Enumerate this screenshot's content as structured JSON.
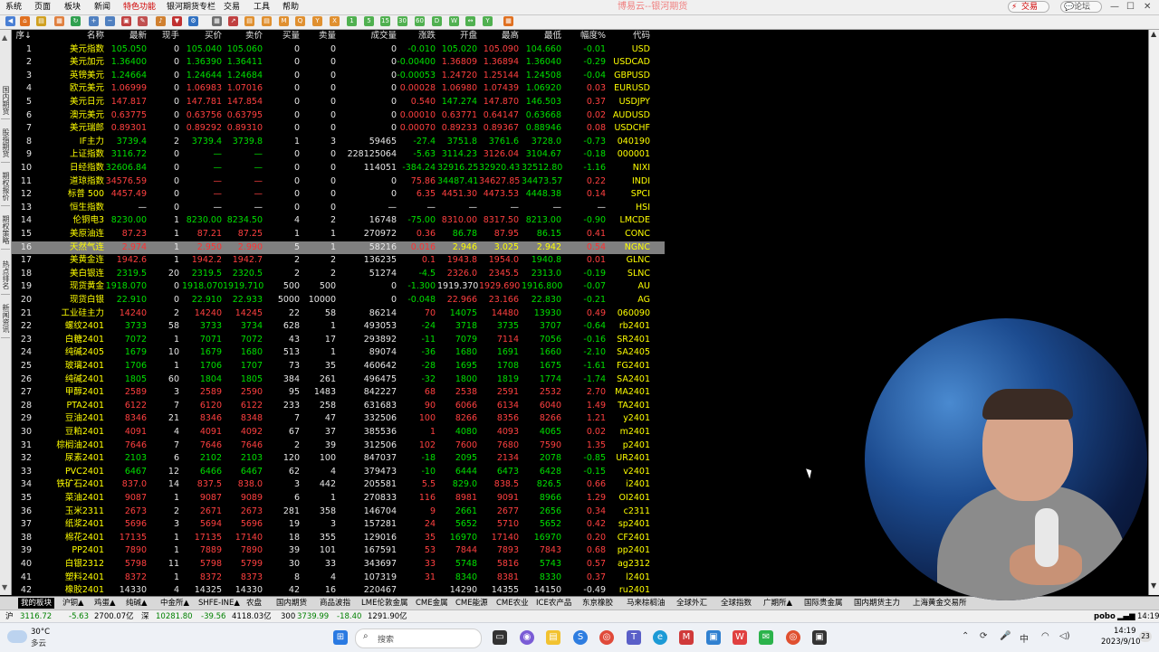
{
  "window": {
    "title": "博易云--银河期货",
    "menu": [
      "系统",
      "页面",
      "板块",
      "新闻",
      "特色功能",
      "银河期货专栏",
      "交易",
      "工具",
      "帮助"
    ],
    "active_menu": "特色功能",
    "trade_button": "交易",
    "forum_button": "论坛"
  },
  "side_tabs": [
    "国内期货",
    "股指期货",
    "期权报价",
    "期权策略",
    "热点排名",
    "新闻资讯"
  ],
  "table": {
    "headers": [
      "序↓",
      "名称",
      "最新",
      "现手",
      "买价",
      "卖价",
      "买量",
      "卖量",
      "成交量",
      "涨跌",
      "开盘",
      "最高",
      "最低",
      "幅度%",
      "代码"
    ],
    "highlight_row_index": 15,
    "rows": [
      [
        "1",
        "美元指数",
        "105.050",
        "0",
        "105.040",
        "105.060",
        "0",
        "0",
        "0",
        "-0.010",
        "105.020",
        "105.090",
        "104.660",
        "-0.01",
        "USD"
      ],
      [
        "2",
        "美元加元",
        "1.36400",
        "0",
        "1.36390",
        "1.36411",
        "0",
        "0",
        "0",
        "-0.00400",
        "1.36809",
        "1.36894",
        "1.36040",
        "-0.29",
        "USDCAD"
      ],
      [
        "3",
        "英镑美元",
        "1.24664",
        "0",
        "1.24644",
        "1.24684",
        "0",
        "0",
        "0",
        "-0.00053",
        "1.24720",
        "1.25144",
        "1.24508",
        "-0.04",
        "GBPUSD"
      ],
      [
        "4",
        "欧元美元",
        "1.06999",
        "0",
        "1.06983",
        "1.07016",
        "0",
        "0",
        "0",
        "0.00028",
        "1.06980",
        "1.07439",
        "1.06920",
        "0.03",
        "EURUSD"
      ],
      [
        "5",
        "美元日元",
        "147.817",
        "0",
        "147.781",
        "147.854",
        "0",
        "0",
        "0",
        "0.540",
        "147.274",
        "147.870",
        "146.503",
        "0.37",
        "USDJPY"
      ],
      [
        "6",
        "澳元美元",
        "0.63775",
        "0",
        "0.63756",
        "0.63795",
        "0",
        "0",
        "0",
        "0.00010",
        "0.63771",
        "0.64147",
        "0.63668",
        "0.02",
        "AUDUSD"
      ],
      [
        "7",
        "美元瑞郎",
        "0.89301",
        "0",
        "0.89292",
        "0.89310",
        "0",
        "0",
        "0",
        "0.00070",
        "0.89233",
        "0.89367",
        "0.88946",
        "0.08",
        "USDCHF"
      ],
      [
        "8",
        "IF主力",
        "3739.4",
        "2",
        "3739.4",
        "3739.8",
        "1",
        "3",
        "59465",
        "-27.4",
        "3751.8",
        "3761.6",
        "3728.0",
        "-0.73",
        "040190"
      ],
      [
        "9",
        "上证指数",
        "3116.72",
        "0",
        "—",
        "—",
        "0",
        "0",
        "228125064",
        "-5.63",
        "3114.23",
        "3126.04",
        "3104.67",
        "-0.18",
        "000001"
      ],
      [
        "10",
        "日经指数",
        "32606.84",
        "0",
        "—",
        "—",
        "0",
        "0",
        "114051",
        "-384.24",
        "32916.25",
        "32920.43",
        "32512.80",
        "-1.16",
        "NIXI"
      ],
      [
        "11",
        "道琼指数",
        "34576.59",
        "0",
        "—",
        "—",
        "0",
        "0",
        "0",
        "75.86",
        "34487.41",
        "34627.85",
        "34473.57",
        "0.22",
        "INDI"
      ],
      [
        "12",
        "标普 500",
        "4457.49",
        "0",
        "—",
        "—",
        "0",
        "0",
        "0",
        "6.35",
        "4451.30",
        "4473.53",
        "4448.38",
        "0.14",
        "SPCI"
      ],
      [
        "13",
        "恒生指数",
        "—",
        "0",
        "—",
        "—",
        "0",
        "0",
        "—",
        "—",
        "—",
        "—",
        "—",
        "—",
        "HSI"
      ],
      [
        "14",
        "伦铜电3",
        "8230.00",
        "1",
        "8230.00",
        "8234.50",
        "4",
        "2",
        "16748",
        "-75.00",
        "8310.00",
        "8317.50",
        "8213.00",
        "-0.90",
        "LMCDE"
      ],
      [
        "15",
        "美原油连",
        "87.23",
        "1",
        "87.21",
        "87.25",
        "1",
        "1",
        "270972",
        "0.36",
        "86.78",
        "87.95",
        "86.15",
        "0.41",
        "CONC"
      ],
      [
        "16",
        "天然气连",
        "2.974",
        "1",
        "2.950",
        "2.990",
        "5",
        "1",
        "58216",
        "0.016",
        "2.946",
        "3.025",
        "2.942",
        "0.54",
        "NGNC"
      ],
      [
        "17",
        "美黄金连",
        "1942.6",
        "1",
        "1942.2",
        "1942.7",
        "2",
        "2",
        "136235",
        "0.1",
        "1943.8",
        "1954.0",
        "1940.8",
        "0.01",
        "GLNC"
      ],
      [
        "18",
        "美白银连",
        "2319.5",
        "20",
        "2319.5",
        "2320.5",
        "2",
        "2",
        "51274",
        "-4.5",
        "2326.0",
        "2345.5",
        "2313.0",
        "-0.19",
        "SLNC"
      ],
      [
        "19",
        "现货黄金",
        "1918.070",
        "0",
        "1918.070",
        "1919.710",
        "500",
        "500",
        "0",
        "-1.300",
        "1919.370",
        "1929.690",
        "1916.800",
        "-0.07",
        "AU"
      ],
      [
        "20",
        "现货白银",
        "22.910",
        "0",
        "22.910",
        "22.933",
        "5000",
        "10000",
        "0",
        "-0.048",
        "22.966",
        "23.166",
        "22.830",
        "-0.21",
        "AG"
      ],
      [
        "21",
        "工业硅主力",
        "14240",
        "2",
        "14240",
        "14245",
        "22",
        "58",
        "86214",
        "70",
        "14075",
        "14480",
        "13930",
        "0.49",
        "060090"
      ],
      [
        "22",
        "螺纹2401",
        "3733",
        "58",
        "3733",
        "3734",
        "628",
        "1",
        "493053",
        "-24",
        "3718",
        "3735",
        "3707",
        "-0.64",
        "rb2401"
      ],
      [
        "23",
        "白糖2401",
        "7072",
        "1",
        "7071",
        "7072",
        "43",
        "17",
        "293892",
        "-11",
        "7079",
        "7114",
        "7056",
        "-0.16",
        "SR2401"
      ],
      [
        "24",
        "纯碱2405",
        "1679",
        "10",
        "1679",
        "1680",
        "513",
        "1",
        "89074",
        "-36",
        "1680",
        "1691",
        "1660",
        "-2.10",
        "SA2405"
      ],
      [
        "25",
        "玻璃2401",
        "1706",
        "1",
        "1706",
        "1707",
        "73",
        "35",
        "460642",
        "-28",
        "1695",
        "1708",
        "1675",
        "-1.61",
        "FG2401"
      ],
      [
        "26",
        "纯碱2401",
        "1805",
        "60",
        "1804",
        "1805",
        "384",
        "261",
        "496475",
        "-32",
        "1800",
        "1819",
        "1774",
        "-1.74",
        "SA2401"
      ],
      [
        "27",
        "甲醇2401",
        "2589",
        "3",
        "2589",
        "2590",
        "95",
        "1483",
        "842227",
        "68",
        "2538",
        "2591",
        "2532",
        "2.70",
        "MA2401"
      ],
      [
        "28",
        "PTA2401",
        "6122",
        "7",
        "6120",
        "6122",
        "233",
        "258",
        "631683",
        "90",
        "6066",
        "6134",
        "6040",
        "1.49",
        "TA2401"
      ],
      [
        "29",
        "豆油2401",
        "8346",
        "21",
        "8346",
        "8348",
        "7",
        "47",
        "332506",
        "100",
        "8266",
        "8356",
        "8266",
        "1.21",
        "y2401"
      ],
      [
        "30",
        "豆粕2401",
        "4091",
        "4",
        "4091",
        "4092",
        "67",
        "37",
        "385536",
        "1",
        "4080",
        "4093",
        "4065",
        "0.02",
        "m2401"
      ],
      [
        "31",
        "棕榈油2401",
        "7646",
        "7",
        "7646",
        "7646",
        "2",
        "39",
        "312506",
        "102",
        "7600",
        "7680",
        "7590",
        "1.35",
        "p2401"
      ],
      [
        "32",
        "尿素2401",
        "2103",
        "6",
        "2102",
        "2103",
        "120",
        "100",
        "847037",
        "-18",
        "2095",
        "2134",
        "2078",
        "-0.85",
        "UR2401"
      ],
      [
        "33",
        "PVC2401",
        "6467",
        "12",
        "6466",
        "6467",
        "62",
        "4",
        "379473",
        "-10",
        "6444",
        "6473",
        "6428",
        "-0.15",
        "v2401"
      ],
      [
        "34",
        "铁矿石2401",
        "837.0",
        "14",
        "837.5",
        "838.0",
        "3",
        "442",
        "205581",
        "5.5",
        "829.0",
        "838.5",
        "826.5",
        "0.66",
        "i2401"
      ],
      [
        "35",
        "菜油2401",
        "9087",
        "1",
        "9087",
        "9089",
        "6",
        "1",
        "270833",
        "116",
        "8981",
        "9091",
        "8966",
        "1.29",
        "OI2401"
      ],
      [
        "36",
        "玉米2311",
        "2673",
        "2",
        "2671",
        "2673",
        "281",
        "358",
        "146704",
        "9",
        "2661",
        "2677",
        "2656",
        "0.34",
        "c2311"
      ],
      [
        "37",
        "纸浆2401",
        "5696",
        "3",
        "5694",
        "5696",
        "19",
        "3",
        "157281",
        "24",
        "5652",
        "5710",
        "5652",
        "0.42",
        "sp2401"
      ],
      [
        "38",
        "棉花2401",
        "17135",
        "1",
        "17135",
        "17140",
        "18",
        "355",
        "129016",
        "35",
        "16970",
        "17140",
        "16970",
        "0.20",
        "CF2401"
      ],
      [
        "39",
        "PP2401",
        "7890",
        "1",
        "7889",
        "7890",
        "39",
        "101",
        "167591",
        "53",
        "7844",
        "7893",
        "7843",
        "0.68",
        "pp2401"
      ],
      [
        "40",
        "白银2312",
        "5798",
        "11",
        "5798",
        "5799",
        "30",
        "33",
        "343697",
        "33",
        "5748",
        "5816",
        "5743",
        "0.57",
        "ag2312"
      ],
      [
        "41",
        "塑料2401",
        "8372",
        "1",
        "8372",
        "8373",
        "8",
        "4",
        "107319",
        "31",
        "8340",
        "8381",
        "8330",
        "0.37",
        "l2401"
      ],
      [
        "42",
        "橡胶2401",
        "14330",
        "4",
        "14325",
        "14330",
        "42",
        "16",
        "220467",
        "",
        "14290",
        "14355",
        "14150",
        "-0.49",
        "ru2401"
      ]
    ]
  },
  "bottom_tabs": [
    "我的板块",
    "沪铜▲",
    "鸡蛋▲",
    "纯碱▲",
    "中金所▲",
    "SHFE-INE▲",
    "农盘",
    "国内期货",
    "商品波指",
    "LME伦敦金属",
    "CME金属",
    "CME能源",
    "CME农业",
    "ICE农产品",
    "东京橡胶",
    "马来棕榈油",
    "全球外汇",
    "全球指数",
    "广期所▲",
    "国际贵金属",
    "国内期货主力",
    "上海黄金交易所"
  ],
  "status": {
    "sh_label": "沪",
    "sh_value": "3116.72",
    "sh_change": "-5.63",
    "sh_amount": "2700.07亿",
    "sz_label": "深",
    "sz_value": "10281.80",
    "sz_change": "-39.56",
    "sz_amount": "4118.03亿",
    "idx300_label": "300",
    "idx300_value": "3739.99",
    "idx300_change": "-18.40",
    "idx300_amount": "1291.90亿",
    "brand": "pobo",
    "time": "14:19"
  },
  "taskbar": {
    "weather_temp": "30°C",
    "weather_desc": "多云",
    "search_placeholder": "搜索",
    "clock_time": "14:19",
    "clock_date": "2023/9/10",
    "notification_count": "23"
  },
  "colors": {
    "up": "#ff4040",
    "down": "#00e000",
    "neutral": "#e8e8e8",
    "name": "#ffff00",
    "code": "#ffff00",
    "highlight_row": "#808080"
  }
}
